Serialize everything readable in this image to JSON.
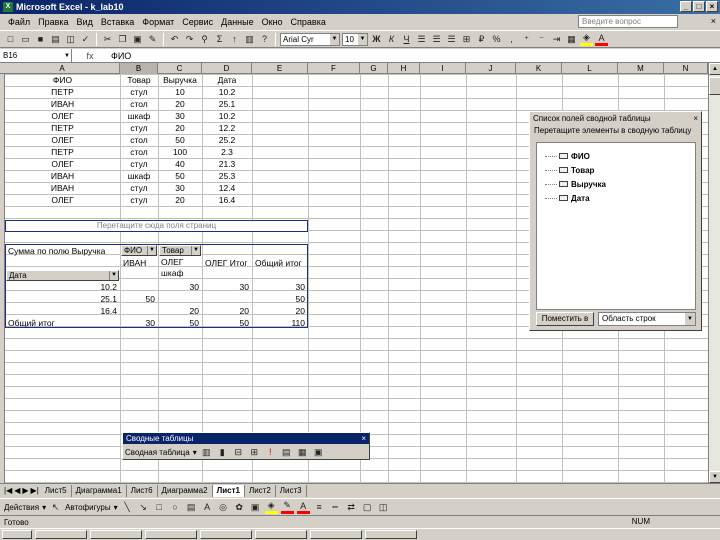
{
  "window": {
    "title": "Microsoft Excel - k_lab10",
    "btn_min": "_",
    "btn_max": "□",
    "btn_close": "×"
  },
  "menu": [
    "Файл",
    "Правка",
    "Вид",
    "Вставка",
    "Формат",
    "Сервис",
    "Данные",
    "Окно",
    "Справка"
  ],
  "help_placeholder": "Введите вопрос",
  "menu_close": "×",
  "toolbar": {
    "font_name": "Arial Cyr",
    "font_size": "10"
  },
  "formula": {
    "namebox": "B16",
    "fx": "fx",
    "value": "ФИО"
  },
  "columns": [
    "A",
    "B",
    "C",
    "D",
    "E",
    "F",
    "G",
    "H",
    "I",
    "J",
    "K",
    "L",
    "M",
    "N"
  ],
  "source_table": {
    "headers": [
      "ФИО",
      "Товар",
      "Выручка",
      "Дата"
    ],
    "rows": [
      [
        "ПЕТР",
        "стул",
        "10",
        "10.2"
      ],
      [
        "ИВАН",
        "стол",
        "20",
        "25.1"
      ],
      [
        "ОЛЕГ",
        "шкаф",
        "30",
        "10.2"
      ],
      [
        "ПЕТР",
        "стул",
        "20",
        "12.2"
      ],
      [
        "ОЛЕГ",
        "стол",
        "50",
        "25.2"
      ],
      [
        "ПЕТР",
        "стол",
        "100",
        "2.3"
      ],
      [
        "ОЛЕГ",
        "стул",
        "40",
        "21.3"
      ],
      [
        "ИВАН",
        "шкаф",
        "50",
        "25.3"
      ],
      [
        "ИВАН",
        "стул",
        "30",
        "12.4"
      ],
      [
        "ОЛЕГ",
        "стул",
        "20",
        "16.4"
      ]
    ]
  },
  "pivot": {
    "page_drop": "Перетащите сюда поля страниц",
    "data_label": "Сумма по полю Выручка",
    "field_fio": "ФИО",
    "field_tovar": "Товар",
    "col_items": [
      "ИВАН",
      "ОЛЕГ шкаф",
      "ОЛЕГ Итог",
      "Общий итог"
    ],
    "row_field": "Дата",
    "rows": [
      {
        "label": "10.2",
        "values": [
          "",
          "30",
          "30",
          "30"
        ]
      },
      {
        "label": "25.1",
        "values": [
          "50",
          "",
          "",
          "50"
        ]
      },
      {
        "label": "16.4",
        "values": [
          "",
          "20",
          "20",
          "20"
        ]
      }
    ],
    "total": {
      "label": "Общий итог",
      "values": [
        "30",
        "50",
        "50",
        "110"
      ]
    }
  },
  "pivot_list": {
    "title": "Список полей сводной таблицы",
    "subtitle": "Перетащите элементы в сводную таблицу",
    "fields": [
      "ФИО",
      "Товар",
      "Выручка",
      "Дата"
    ],
    "put_button": "Поместить в",
    "area": "Область строк"
  },
  "pivot_toolbar": {
    "title": "Сводные таблицы",
    "menu": "Сводная таблица"
  },
  "sheet_tabs": [
    "Лист5",
    "Диаграмма1",
    "Лист6",
    "Диаграмма2",
    "Лист1",
    "Лист2",
    "Лист3"
  ],
  "active_sheet": "Лист1",
  "drawbar": {
    "actions": "Действия",
    "autoshapes": "Автофигуры"
  },
  "status": {
    "left": "Готово",
    "num": "NUM"
  }
}
